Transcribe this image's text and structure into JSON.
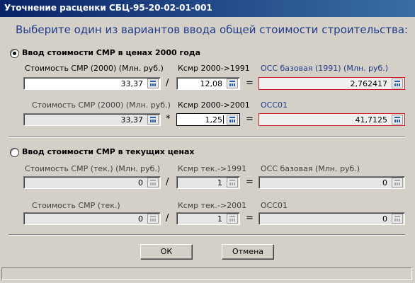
{
  "window": {
    "title": "Уточнение расценки СБЦ-95-20-02-01-001"
  },
  "heading": "Выберите один из вариантов ввода общей стоимости строительства:",
  "section1": {
    "label": "Ввод стоимости СМР в ценах 2000 года",
    "selected": true,
    "row1": {
      "label_cost": "Стоимость СМР (2000) (Млн. руб.)",
      "cost": "33,37",
      "op1": "/",
      "label_k": "Ксмр 2000->1991",
      "k": "12,08",
      "eq": "=",
      "label_result": "ОСС базовая (1991) (Млн. руб.)",
      "result": "2,762417"
    },
    "row2": {
      "label_cost": "Стоимость СМР (2000) (Млн. руб.)",
      "cost": "33,37",
      "op1": "*",
      "label_k": "Ксмр 2000->2001",
      "k": "1,25",
      "eq": "=",
      "label_result": "ОСС01",
      "result": "41,7125"
    }
  },
  "section2": {
    "label": "Ввод стоимости СМР в текущих ценах",
    "selected": false,
    "row1": {
      "label_cost": "Стоимость СМР (тек.) (Млн. руб.)",
      "cost": "0",
      "op1": "/",
      "label_k": "Ксмр тек.->1991",
      "k": "1",
      "eq": "=",
      "label_result": "ОСС базовая (Млн. руб.)",
      "result": "0"
    },
    "row2": {
      "label_cost": "Стоимость СМР (тек.)",
      "cost": "0",
      "op1": "/",
      "label_k": "Ксмр тек.->2001",
      "k": "1",
      "eq": "=",
      "label_result": "ОСС01",
      "result": "0"
    }
  },
  "buttons": {
    "ok": "ОК",
    "cancel": "Отмена"
  },
  "colors": {
    "title_bar": "#0a246a",
    "heading_text": "#1e3a8a",
    "result_border": "#d21e1e"
  },
  "icons": {
    "field_button": "calculator-icon"
  }
}
